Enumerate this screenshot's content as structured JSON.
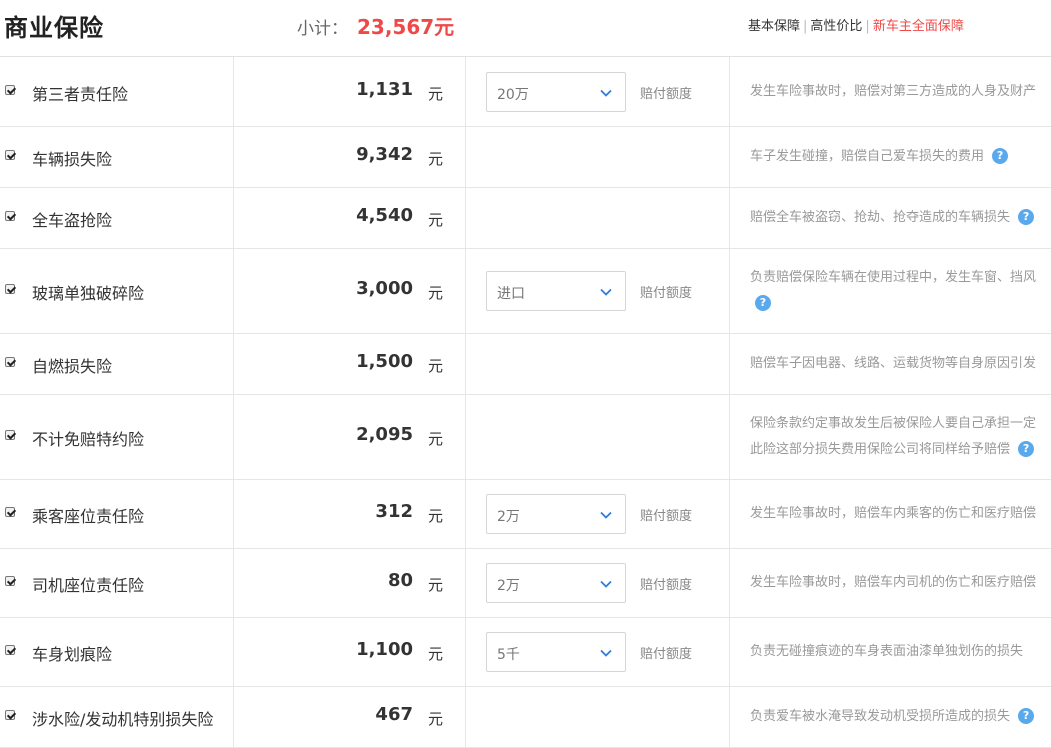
{
  "header": {
    "title": "商业保险",
    "subtotal_label": "小计：",
    "subtotal_value": "23,567元",
    "tabs": [
      "基本保障",
      "高性价比",
      "新车主全面保障"
    ],
    "active_tab": 2
  },
  "colors": {
    "accent": "#f04848",
    "help_icon": "#5aa9ec"
  },
  "rows": [
    {
      "name": "第三者责任险",
      "price": "1,131",
      "unit": "元",
      "select": "20万",
      "amount_label": "赔付额度",
      "desc": [
        "发生车险事故时，赔偿对第三方造成的人身及财产"
      ],
      "help": false
    },
    {
      "name": "车辆损失险",
      "price": "9,342",
      "unit": "元",
      "select": null,
      "amount_label": null,
      "desc": [
        "车子发生碰撞，赔偿自己爱车损失的费用"
      ],
      "help": true
    },
    {
      "name": "全车盗抢险",
      "price": "4,540",
      "unit": "元",
      "select": null,
      "amount_label": null,
      "desc": [
        "赔偿全车被盗窃、抢劫、抢夺造成的车辆损失"
      ],
      "help": true
    },
    {
      "name": "玻璃单独破碎险",
      "price": "3,000",
      "unit": "元",
      "select": "进口",
      "amount_label": "赔付额度",
      "desc": [
        "负责赔偿保险车辆在使用过程中，发生车窗、挡风",
        ""
      ],
      "help": true
    },
    {
      "name": "自燃损失险",
      "price": "1,500",
      "unit": "元",
      "select": null,
      "amount_label": null,
      "desc": [
        "赔偿车子因电器、线路、运载货物等自身原因引发"
      ],
      "help": false
    },
    {
      "name": "不计免赔特约险",
      "price": "2,095",
      "unit": "元",
      "select": null,
      "amount_label": null,
      "desc": [
        "保险条款约定事故发生后被保险人要自己承担一定",
        "此险这部分损失费用保险公司将同样给予赔偿"
      ],
      "help": true
    },
    {
      "name": "乘客座位责任险",
      "price": "312",
      "unit": "元",
      "select": "2万",
      "amount_label": "赔付额度",
      "desc": [
        "发生车险事故时，赔偿车内乘客的伤亡和医疗赔偿"
      ],
      "help": false
    },
    {
      "name": "司机座位责任险",
      "price": "80",
      "unit": "元",
      "select": "2万",
      "amount_label": "赔付额度",
      "desc": [
        "发生车险事故时，赔偿车内司机的伤亡和医疗赔偿"
      ],
      "help": false
    },
    {
      "name": "车身划痕险",
      "price": "1,100",
      "unit": "元",
      "select": "5千",
      "amount_label": "赔付额度",
      "desc": [
        "负责无碰撞痕迹的车身表面油漆单独划伤的损失"
      ],
      "help": false
    },
    {
      "name": "涉水险/发动机特别损失险",
      "price": "467",
      "unit": "元",
      "select": null,
      "amount_label": null,
      "desc": [
        "负责爱车被水淹导致发动机受损所造成的损失"
      ],
      "help": true
    }
  ]
}
